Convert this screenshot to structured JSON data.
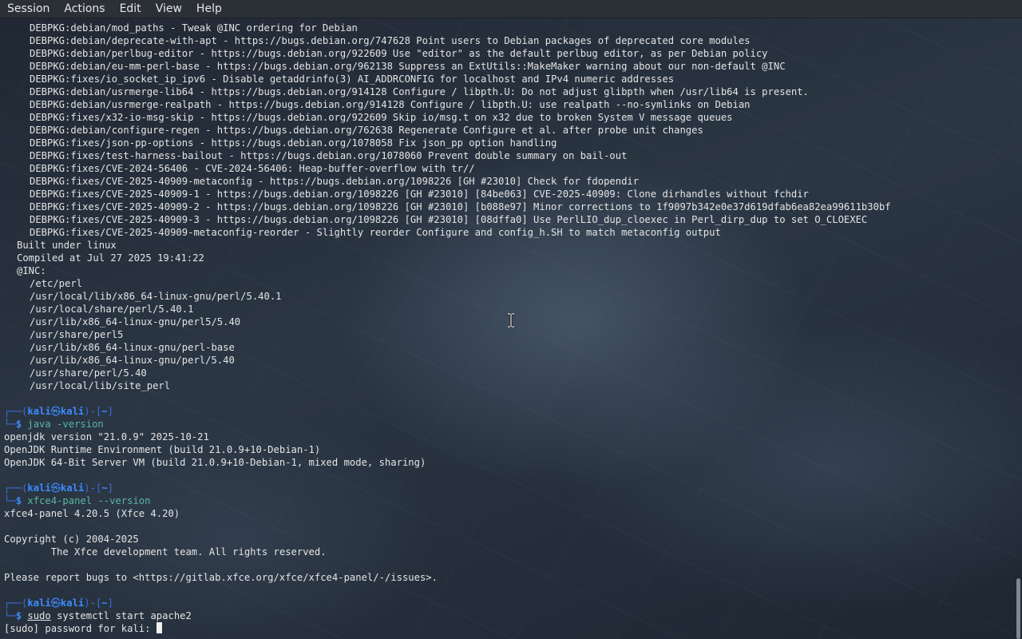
{
  "menubar": {
    "items": [
      "Session",
      "Actions",
      "Edit",
      "View",
      "Help"
    ]
  },
  "perl_patches": [
    "DEBPKG:debian/mod_paths - Tweak @INC ordering for Debian",
    "DEBPKG:debian/deprecate-with-apt - https://bugs.debian.org/747628 Point users to Debian packages of deprecated core modules",
    "DEBPKG:debian/perlbug-editor - https://bugs.debian.org/922609 Use \"editor\" as the default perlbug editor, as per Debian policy",
    "DEBPKG:debian/eu-mm-perl-base - https://bugs.debian.org/962138 Suppress an ExtUtils::MakeMaker warning about our non-default @INC",
    "DEBPKG:fixes/io_socket_ip_ipv6 - Disable getaddrinfo(3) AI_ADDRCONFIG for localhost and IPv4 numeric addresses",
    "DEBPKG:debian/usrmerge-lib64 - https://bugs.debian.org/914128 Configure / libpth.U: Do not adjust glibpth when /usr/lib64 is present.",
    "DEBPKG:debian/usrmerge-realpath - https://bugs.debian.org/914128 Configure / libpth.U: use realpath --no-symlinks on Debian",
    "DEBPKG:fixes/x32-io-msg-skip - https://bugs.debian.org/922609 Skip io/msg.t on x32 due to broken System V message queues",
    "DEBPKG:debian/configure-regen - https://bugs.debian.org/762638 Regenerate Configure et al. after probe unit changes",
    "DEBPKG:fixes/json-pp-options - https://bugs.debian.org/1078058 Fix json_pp option handling",
    "DEBPKG:fixes/test-harness-bailout - https://bugs.debian.org/1078060 Prevent double summary on bail-out",
    "DEBPKG:fixes/CVE-2024-56406 - CVE-2024-56406: Heap-buffer-overflow with tr//",
    "DEBPKG:fixes/CVE-2025-40909-metaconfig - https://bugs.debian.org/1098226 [GH #23010] Check for fdopendir",
    "DEBPKG:fixes/CVE-2025-40909-1 - https://bugs.debian.org/1098226 [GH #23010] [84be063] CVE-2025-40909: Clone dirhandles without fchdir",
    "DEBPKG:fixes/CVE-2025-40909-2 - https://bugs.debian.org/1098226 [GH #23010] [b088e97] Minor corrections to 1f9097b342e0e37d619dfab6ea82ea99611b30bf",
    "DEBPKG:fixes/CVE-2025-40909-3 - https://bugs.debian.org/1098226 [GH #23010] [08dffa0] Use PerlLIO_dup_cloexec in Perl_dirp_dup to set O_CLOEXEC",
    "DEBPKG:fixes/CVE-2025-40909-metaconfig-reorder - Slightly reorder Configure and config_h.SH to match metaconfig output"
  ],
  "built_under": "Built under linux",
  "compiled_at": "Compiled at Jul 27 2025 19:41:22",
  "inc_label": "@INC:",
  "inc_paths": [
    "/etc/perl",
    "/usr/local/lib/x86_64-linux-gnu/perl/5.40.1",
    "/usr/local/share/perl/5.40.1",
    "/usr/lib/x86_64-linux-gnu/perl5/5.40",
    "/usr/share/perl5",
    "/usr/lib/x86_64-linux-gnu/perl-base",
    "/usr/lib/x86_64-linux-gnu/perl/5.40",
    "/usr/share/perl/5.40",
    "/usr/local/lib/site_perl"
  ],
  "prompt": {
    "top_prefix": "┌──(",
    "user": "kali",
    "at": "㉿",
    "host": "kali",
    "mid": ")-[",
    "dir": "~",
    "end": "]",
    "bottom_prefix": "└─",
    "symbol": "$"
  },
  "java_cmd": "java -version",
  "java_output": [
    "openjdk version \"21.0.9\" 2025-10-21",
    "OpenJDK Runtime Environment (build 21.0.9+10-Debian-1)",
    "OpenJDK 64-Bit Server VM (build 21.0.9+10-Debian-1, mixed mode, sharing)"
  ],
  "xfce_cmd": "xfce4-panel --version",
  "xfce_version": "xfce4-panel 4.20.5 (Xfce 4.20)",
  "xfce_copyright": "Copyright (c) 2004-2025",
  "xfce_team": "        The Xfce development team. All rights reserved.",
  "xfce_bugs": "Please report bugs to <https://gitlab.xfce.org/xfce/xfce4-panel/-/issues>.",
  "sudo_cmd_sudo": "sudo",
  "sudo_cmd_rest": " systemctl start apache2",
  "sudo_password_prompt": "[sudo] password for kali: "
}
